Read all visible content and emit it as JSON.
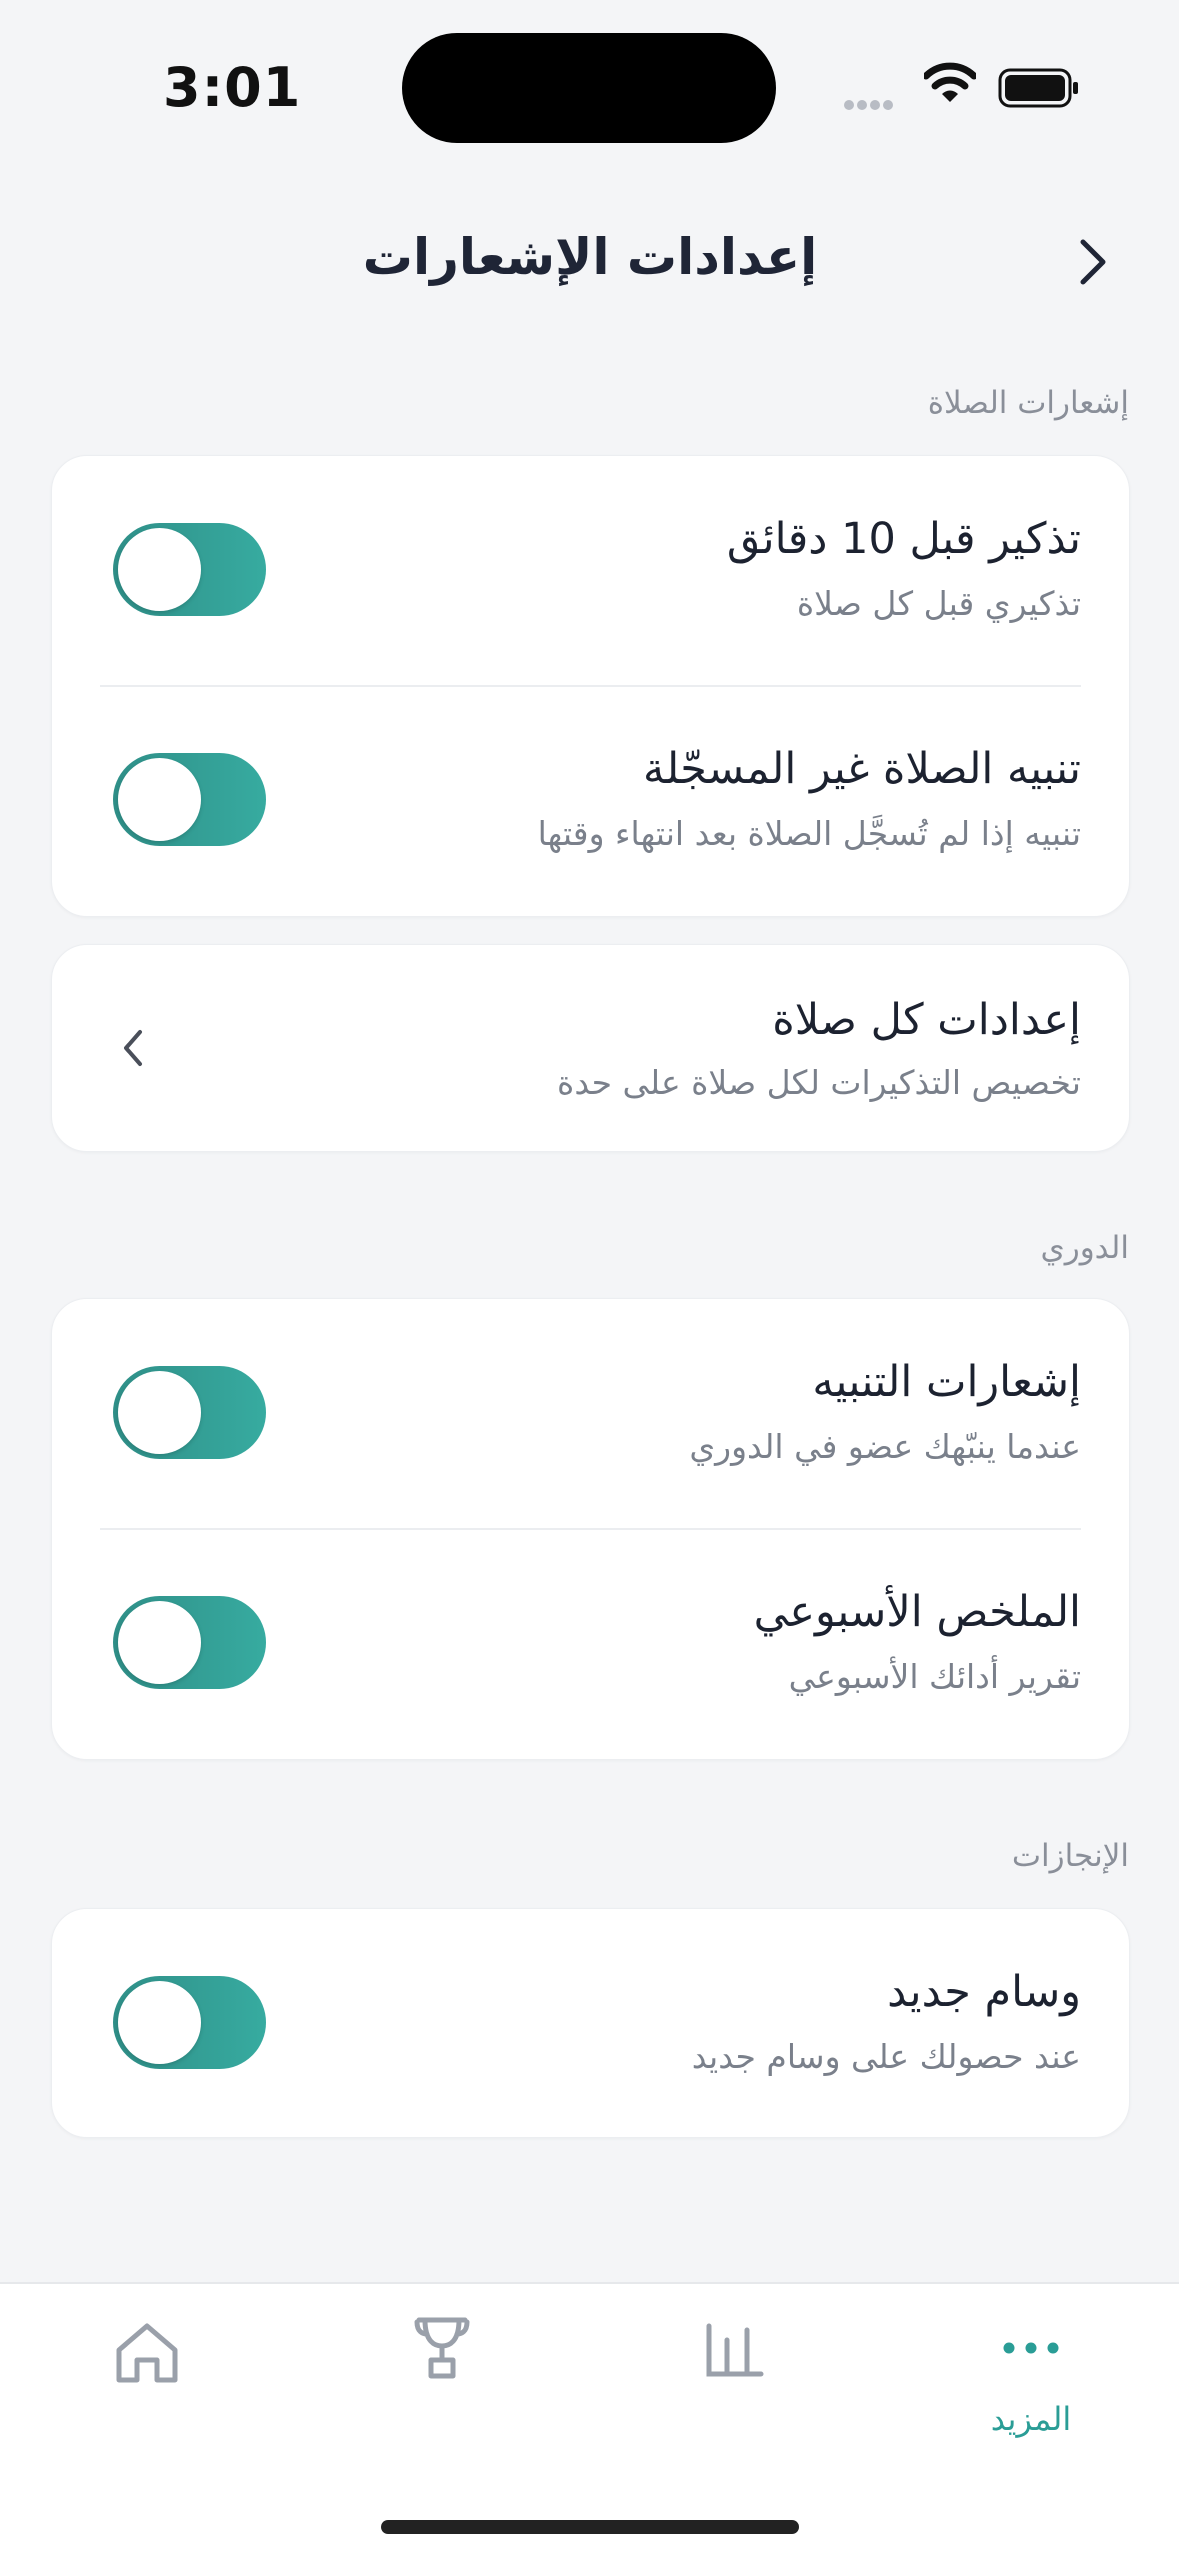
{
  "status_bar": {
    "time": "3:01"
  },
  "header": {
    "title": "إعدادات الإشعارات"
  },
  "sections": {
    "prayer": {
      "label": "إشعارات الصلاة",
      "rows": [
        {
          "title": "تذكير قبل 10 دقائق",
          "subtitle": "تذكيري قبل كل صلاة",
          "enabled": true
        },
        {
          "title": "تنبيه الصلاة غير المسجّلة",
          "subtitle": "تنبيه إذا لم تُسجَّل الصلاة بعد انتهاء وقتها",
          "enabled": true
        }
      ],
      "per_prayer": {
        "title": "إعدادات كل صلاة",
        "subtitle": "تخصيص التذكيرات لكل صلاة على حدة"
      }
    },
    "league": {
      "label": "الدوري",
      "rows": [
        {
          "title": "إشعارات التنبيه",
          "subtitle": "عندما ينبّهك عضو في الدوري",
          "enabled": true
        },
        {
          "title": "الملخص الأسبوعي",
          "subtitle": "تقرير أدائك الأسبوعي",
          "enabled": true
        }
      ]
    },
    "achievements": {
      "label": "الإنجازات",
      "rows": [
        {
          "title": "وسام جديد",
          "subtitle": "عند حصولك على وسام جديد",
          "enabled": true
        }
      ]
    }
  },
  "tabbar": {
    "active_color": "#2a9d96",
    "inactive_color": "#9aa0aa",
    "more_label": "المزيد"
  },
  "colors": {
    "accent": "#2f9f97",
    "background": "#f4f5f7"
  }
}
